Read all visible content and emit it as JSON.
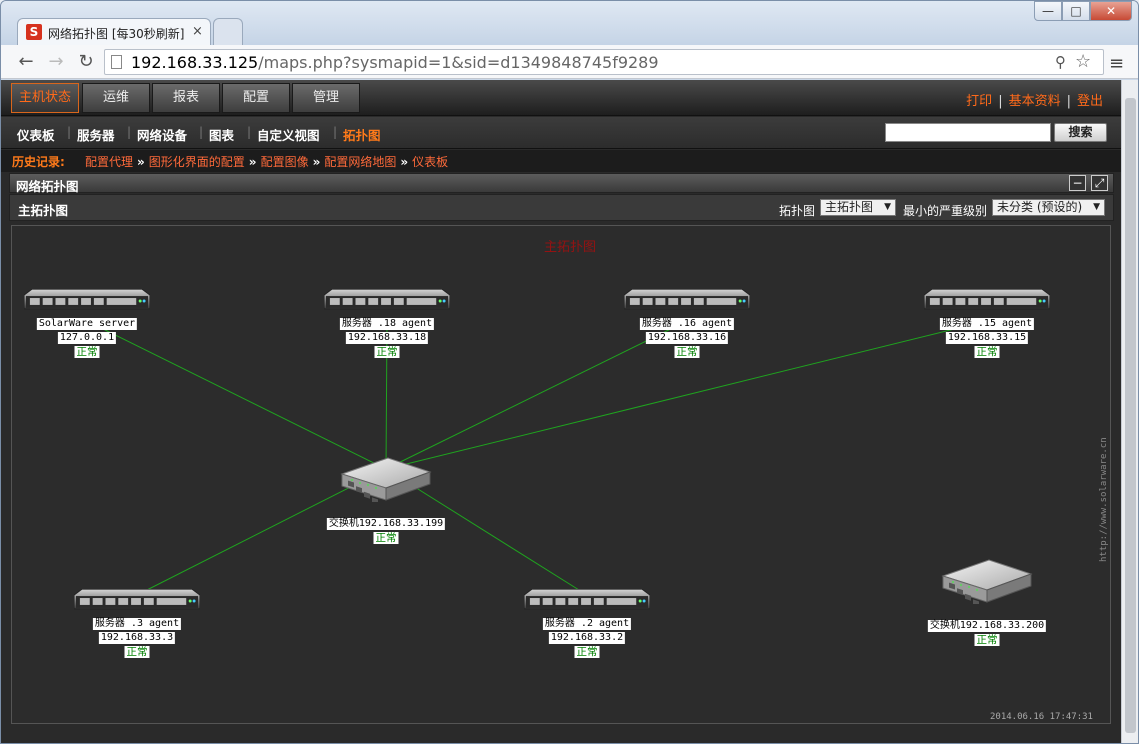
{
  "browser": {
    "tab_title": "网络拓扑图 [每30秒刷新]",
    "tab_close": "×",
    "favicon_letter": "S",
    "url_host": "192.168.33.125",
    "url_path": "/maps.php?sysmapid=1&sid=d1349848745f9289",
    "window_buttons": {
      "minimize": "—",
      "maximize": "□",
      "close": "✕"
    }
  },
  "topmenu": {
    "tabs": [
      "主机状态",
      "运维",
      "报表",
      "配置",
      "管理"
    ],
    "active_index": 0,
    "right_links": [
      "打印",
      "基本资料",
      "登出"
    ]
  },
  "subnav": {
    "items": [
      "仪表板",
      "服务器",
      "网络设备",
      "图表",
      "自定义视图",
      "拓扑图"
    ],
    "active_index": 5,
    "search_value": "",
    "search_button": "搜索"
  },
  "history": {
    "label": "历史记录:",
    "items": [
      "配置代理",
      "图形化界面的配置",
      "配置图像",
      "配置网络地图",
      "仪表板"
    ],
    "separator": "»"
  },
  "panel": {
    "title": "网络拓扑图"
  },
  "maphdr": {
    "title": "主拓扑图",
    "map_label": "拓扑图",
    "map_select": "主拓扑图",
    "severity_label": "最小的严重级别",
    "severity_select": "未分类 (预设的)"
  },
  "map": {
    "title": "主拓扑图",
    "timestamp": "2014.06.16 17:47:31",
    "watermark": "http://www.solarware.cn",
    "link_color": "#1fa31f",
    "status_color": "#008000",
    "nodes": [
      {
        "id": "n1",
        "type": "server",
        "name": "SolarWare server",
        "ip": "127.0.0.1",
        "status": "正常"
      },
      {
        "id": "n2",
        "type": "server",
        "name": "服务器 .18 agent",
        "ip": "192.168.33.18",
        "status": "正常"
      },
      {
        "id": "n3",
        "type": "server",
        "name": "服务器 .16 agent",
        "ip": "192.168.33.16",
        "status": "正常"
      },
      {
        "id": "n4",
        "type": "server",
        "name": "服务器 .15 agent",
        "ip": "192.168.33.15",
        "status": "正常"
      },
      {
        "id": "sw1",
        "type": "switch",
        "name": "交换机192.168.33.199",
        "ip": "",
        "status": "正常"
      },
      {
        "id": "n5",
        "type": "server",
        "name": "服务器 .3 agent",
        "ip": "192.168.33.3",
        "status": "正常"
      },
      {
        "id": "n6",
        "type": "server",
        "name": "服务器 .2 agent",
        "ip": "192.168.33.2",
        "status": "正常"
      },
      {
        "id": "sw2",
        "type": "switch",
        "name": "交换机192.168.33.200",
        "ip": "",
        "status": "正常"
      }
    ],
    "links": [
      [
        "sw1",
        "n1"
      ],
      [
        "sw1",
        "n2"
      ],
      [
        "sw1",
        "n3"
      ],
      [
        "sw1",
        "n4"
      ],
      [
        "sw1",
        "n5"
      ],
      [
        "sw1",
        "n6"
      ]
    ]
  }
}
